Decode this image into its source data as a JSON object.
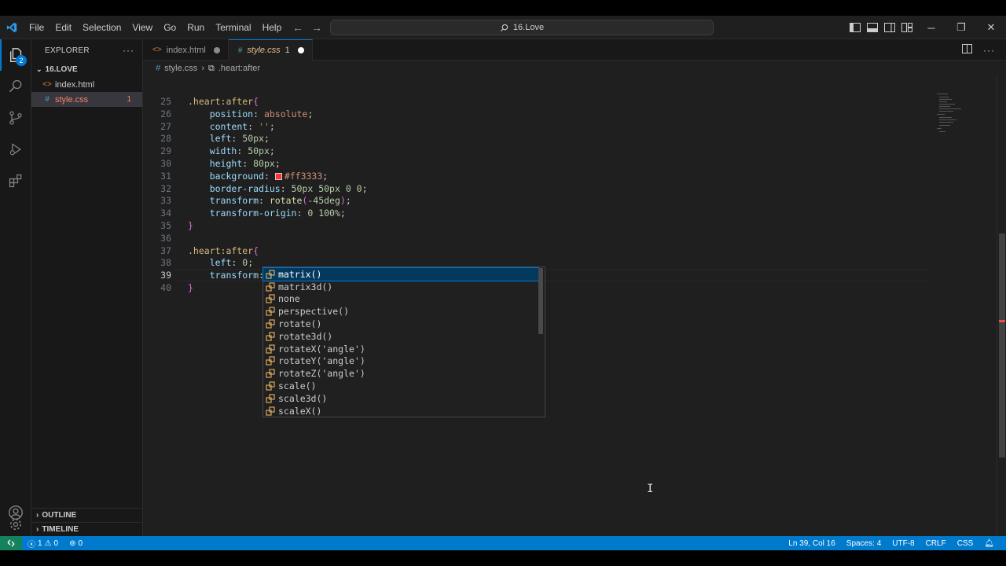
{
  "menu": [
    "File",
    "Edit",
    "Selection",
    "View",
    "Go",
    "Run",
    "Terminal",
    "Help"
  ],
  "search_title": "16.Love",
  "sidebar": {
    "title": "EXPLORER",
    "folder": "16.LOVE",
    "files": [
      {
        "name": "index.html",
        "icon": "<>",
        "color": "#e37933",
        "count": ""
      },
      {
        "name": "style.css",
        "icon": "#",
        "color": "#519aba",
        "count": "1"
      }
    ],
    "outline": "OUTLINE",
    "timeline": "TIMELINE"
  },
  "tabs": [
    {
      "label": "index.html",
      "icon": "<>",
      "num": ""
    },
    {
      "label": "style.css",
      "icon": "#",
      "num": "1"
    }
  ],
  "breadcrumb": {
    "file": "style.css",
    "symbol": ".heart:after"
  },
  "code_lines": [
    {
      "n": "25",
      "parts": [
        {
          "t": ".heart:after",
          "c": "sel"
        },
        {
          "t": "{",
          "c": "brace"
        }
      ]
    },
    {
      "n": "26",
      "parts": [
        {
          "t": "    "
        },
        {
          "t": "position",
          "c": "prop"
        },
        {
          "t": ": "
        },
        {
          "t": "absolute",
          "c": "val"
        },
        {
          "t": ";"
        }
      ]
    },
    {
      "n": "27",
      "parts": [
        {
          "t": "    "
        },
        {
          "t": "content",
          "c": "prop"
        },
        {
          "t": ": "
        },
        {
          "t": "''",
          "c": "val"
        },
        {
          "t": ";"
        }
      ]
    },
    {
      "n": "28",
      "parts": [
        {
          "t": "    "
        },
        {
          "t": "left",
          "c": "prop"
        },
        {
          "t": ": "
        },
        {
          "t": "50px",
          "c": "num"
        },
        {
          "t": ";"
        }
      ]
    },
    {
      "n": "29",
      "parts": [
        {
          "t": "    "
        },
        {
          "t": "width",
          "c": "prop"
        },
        {
          "t": ": "
        },
        {
          "t": "50px",
          "c": "num"
        },
        {
          "t": ";"
        }
      ]
    },
    {
      "n": "30",
      "parts": [
        {
          "t": "    "
        },
        {
          "t": "height",
          "c": "prop"
        },
        {
          "t": ": "
        },
        {
          "t": "80px",
          "c": "num"
        },
        {
          "t": ";"
        }
      ]
    },
    {
      "n": "31",
      "parts": [
        {
          "t": "    "
        },
        {
          "t": "background",
          "c": "prop"
        },
        {
          "t": ": "
        },
        {
          "swatch": true
        },
        {
          "t": "#ff3333",
          "c": "val"
        },
        {
          "t": ";"
        }
      ]
    },
    {
      "n": "32",
      "parts": [
        {
          "t": "    "
        },
        {
          "t": "border-radius",
          "c": "prop"
        },
        {
          "t": ": "
        },
        {
          "t": "50px 50px 0 0",
          "c": "num"
        },
        {
          "t": ";"
        }
      ]
    },
    {
      "n": "33",
      "parts": [
        {
          "t": "    "
        },
        {
          "t": "transform",
          "c": "prop"
        },
        {
          "t": ": "
        },
        {
          "t": "rotate",
          "c": "fn"
        },
        {
          "t": "(",
          "c": "brace"
        },
        {
          "t": "-45deg",
          "c": "num"
        },
        {
          "t": ")",
          "c": "brace"
        },
        {
          "t": ";"
        }
      ]
    },
    {
      "n": "34",
      "parts": [
        {
          "t": "    "
        },
        {
          "t": "transform-origin",
          "c": "prop"
        },
        {
          "t": ": "
        },
        {
          "t": "0 100%",
          "c": "num"
        },
        {
          "t": ";"
        }
      ]
    },
    {
      "n": "35",
      "parts": [
        {
          "t": "}",
          "c": "brace"
        }
      ]
    },
    {
      "n": "36",
      "parts": []
    },
    {
      "n": "37",
      "parts": [
        {
          "t": ".heart:after",
          "c": "sel"
        },
        {
          "t": "{",
          "c": "brace"
        }
      ]
    },
    {
      "n": "38",
      "parts": [
        {
          "t": "    "
        },
        {
          "t": "left",
          "c": "prop"
        },
        {
          "t": ": "
        },
        {
          "t": "0",
          "c": "num"
        },
        {
          "t": ";"
        }
      ]
    },
    {
      "n": "39",
      "parts": [
        {
          "t": "    "
        },
        {
          "t": "transform",
          "c": "prop"
        },
        {
          "t": ": "
        },
        {
          "cursor": true
        },
        {
          "t": ";"
        }
      ],
      "current": true
    },
    {
      "n": "40",
      "parts": [
        {
          "t": "}",
          "c": "brace"
        }
      ]
    }
  ],
  "suggestions": [
    "matrix()",
    "matrix3d()",
    "none",
    "perspective()",
    "rotate()",
    "rotate3d()",
    "rotateX('angle')",
    "rotateY('angle')",
    "rotateZ('angle')",
    "scale()",
    "scale3d()",
    "scaleX()"
  ],
  "status": {
    "errors": "1",
    "warnings": "0",
    "ports": "0",
    "position": "Ln 39, Col 16",
    "spaces": "Spaces: 4",
    "encoding": "UTF-8",
    "eol": "CRLF",
    "language": "CSS"
  },
  "colors": {
    "accent": "#0078d4",
    "statusbar": "#007acc",
    "error": "#f14c4c"
  }
}
